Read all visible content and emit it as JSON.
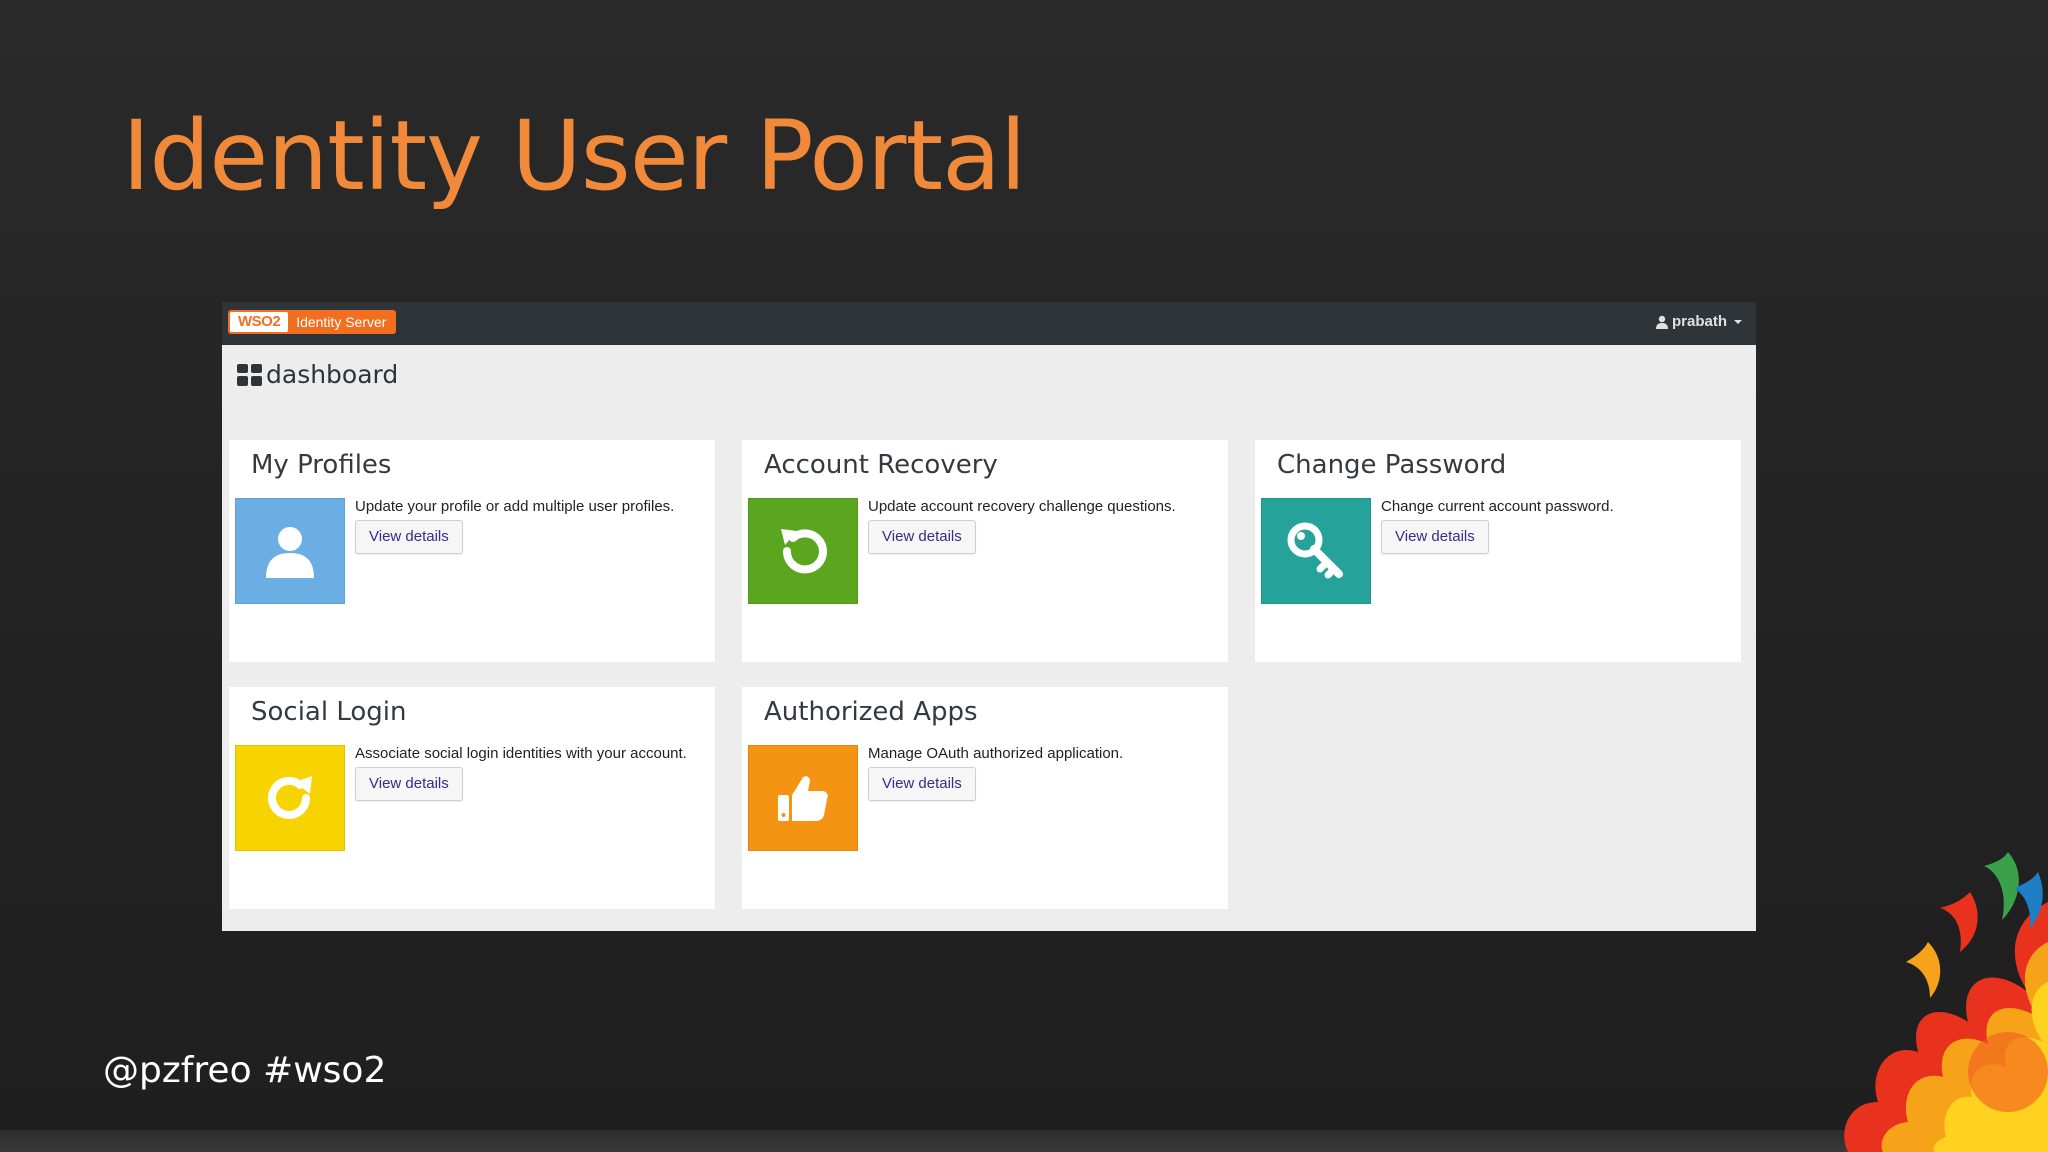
{
  "slide": {
    "title": "Identity User Portal",
    "footer": "@pzfreo #wso2"
  },
  "portal": {
    "logo": {
      "brand": "WSO2",
      "product": "Identity Server"
    },
    "user_menu": {
      "username": "prabath"
    },
    "dashboard_title": "dashboard",
    "cards": [
      {
        "title": "My Profiles",
        "description": "Update your profile or add multiple user profiles.",
        "button": "View details",
        "tile_color": "#6aaee3",
        "icon": "user-icon"
      },
      {
        "title": "Account Recovery",
        "description": "Update account recovery challenge questions.",
        "button": "View details",
        "tile_color": "#5aa61f",
        "icon": "undo-icon"
      },
      {
        "title": "Change Password",
        "description": "Change current account password.",
        "button": "View details",
        "tile_color": "#25a39b",
        "icon": "key-icon"
      },
      {
        "title": "Social Login",
        "description": "Associate social login identities with your account.",
        "button": "View details",
        "tile_color": "#f7d400",
        "icon": "refresh-icon"
      },
      {
        "title": "Authorized Apps",
        "description": "Manage OAuth authorized application.",
        "button": "View details",
        "tile_color": "#f59313",
        "icon": "thumbs-up-icon"
      }
    ]
  },
  "colors": {
    "slide_title": "#f08a3a",
    "navbar": "#2f3439",
    "brand_orange": "#f26f21"
  }
}
